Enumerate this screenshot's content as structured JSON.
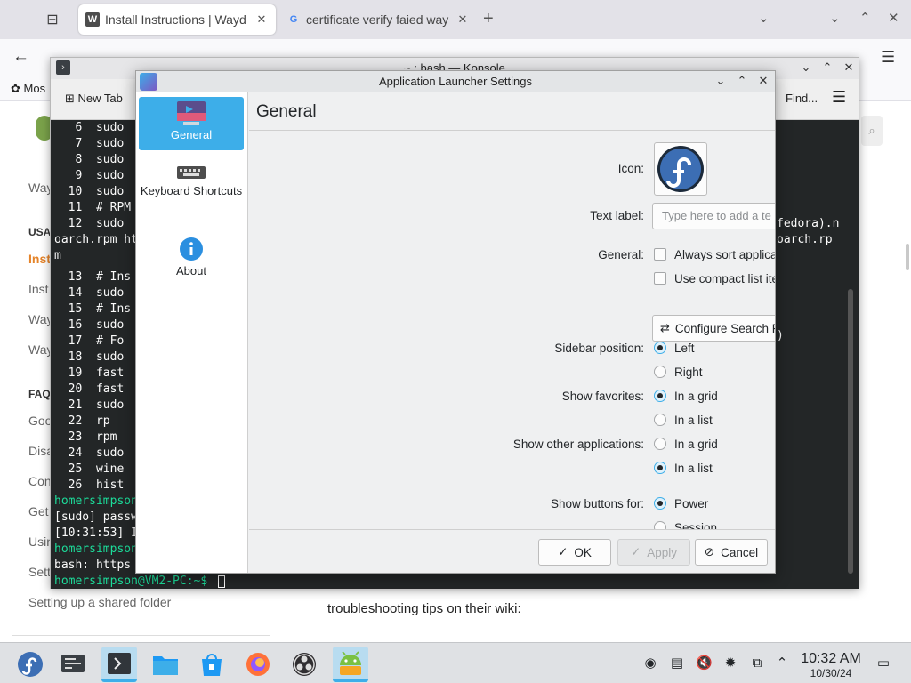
{
  "browser": {
    "tabs": [
      {
        "title": "Install Instructions | Wayd",
        "favicon": "W",
        "active": true
      },
      {
        "title": "certificate verify faied way",
        "favicon": "G",
        "active": false
      }
    ],
    "bookmark_label": "Mos",
    "page": {
      "sidebar_entries": [
        "Way",
        "USA",
        "Inst",
        "Inst",
        "Way",
        "Way",
        "FAQ",
        "Goo",
        "Disa",
        "Con",
        "Get",
        "Usin",
        "Sett",
        "Setting up a shared folder"
      ],
      "body_text": "troubleshooting tips on their wiki:"
    }
  },
  "konsole": {
    "title": "~ : bash — Konsole",
    "toolbar": {
      "new_tab": "New Tab",
      "find": "Find..."
    },
    "left_lines": [
      {
        "text": "   6  sudo",
        "green": false
      },
      {
        "text": "   7  sudo",
        "green": false
      },
      {
        "text": "   8  sudo",
        "green": false
      },
      {
        "text": "   9  sudo",
        "green": false
      },
      {
        "text": "  10  sudo",
        "green": false
      },
      {
        "text": "  11  # RPM",
        "green": false
      },
      {
        "text": "  12  sudo",
        "green": false
      },
      {
        "text": "oarch.rpm ht",
        "green": false
      },
      {
        "text": "m",
        "green": false
      },
      {
        "text": "  13  # Ins",
        "green": false
      },
      {
        "text": "  14  sudo",
        "green": false
      },
      {
        "text": "  15  # Ins",
        "green": false
      },
      {
        "text": "  16  sudo",
        "green": false
      },
      {
        "text": "  17  # Fo",
        "green": false
      },
      {
        "text": "  18  sudo",
        "green": false
      },
      {
        "text": "  19  fast",
        "green": false
      },
      {
        "text": "  20  fast",
        "green": false
      },
      {
        "text": "  21  sudo",
        "green": false
      },
      {
        "text": "  22  rp",
        "green": false
      },
      {
        "text": "  23  rpm",
        "green": false
      },
      {
        "text": "  24  sudo",
        "green": false
      },
      {
        "text": "  25  wine",
        "green": false
      },
      {
        "text": "  26  hist",
        "green": false
      },
      {
        "text": "homersimpson",
        "green": true
      },
      {
        "text": "[sudo] passw",
        "green": false
      },
      {
        "text": "[10:31:53] I",
        "green": false
      },
      {
        "text": "homersimpson",
        "green": true
      },
      {
        "text": "bash: https",
        "green": false
      },
      {
        "text": "homersimpson@VM2-PC:~$",
        "green": true
      }
    ],
    "right_lines": [
      {
        "text": "fedora).n"
      },
      {
        "text": "oarch.rp"
      },
      {
        "text": ")"
      }
    ]
  },
  "dialog": {
    "title": "Application Launcher Settings",
    "categories": [
      {
        "label": "General",
        "icon": "launcher-icon",
        "active": true
      },
      {
        "label": "Keyboard Shortcuts",
        "icon": "keyboard-icon",
        "active": false
      },
      {
        "label": "About",
        "icon": "info-icon",
        "active": false
      }
    ],
    "heading": "General",
    "labels": {
      "icon": "Icon:",
      "text_label": "Text label:",
      "general": "General:",
      "sidebar_position": "Sidebar position:",
      "show_favorites": "Show favorites:",
      "show_other_apps": "Show other applications:",
      "show_buttons": "Show buttons for:"
    },
    "text_label_placeholder": "Type here to add a te",
    "options": {
      "always_sort": {
        "label": "Always sort applica",
        "checked": false
      },
      "compact_list": {
        "label": "Use compact list ite",
        "checked": false
      },
      "sidebar_left": {
        "label": "Left",
        "checked": true
      },
      "sidebar_right": {
        "label": "Right",
        "checked": false
      },
      "fav_grid": {
        "label": "In a grid",
        "checked": true
      },
      "fav_list": {
        "label": "In a list",
        "checked": false
      },
      "other_grid": {
        "label": "In a grid",
        "checked": false
      },
      "other_list": {
        "label": "In a list",
        "checked": true
      },
      "buttons_power": {
        "label": "Power",
        "checked": true
      },
      "buttons_session": {
        "label": "Session",
        "checked": false
      }
    },
    "configure_search_label": "Configure Search F",
    "buttons": {
      "ok": "OK",
      "apply": "Apply",
      "cancel": "Cancel"
    }
  },
  "taskbar": {
    "apps": [
      "fedora-launcher-icon",
      "system-monitor-icon",
      "konsole-icon",
      "files-icon",
      "discover-store-icon",
      "firefox-icon",
      "obs-icon",
      "android-app-icon"
    ],
    "clock": {
      "time": "10:32 AM",
      "date": "10/30/24"
    }
  },
  "colors": {
    "accent": "#3daee9",
    "terminal_bg": "#232627",
    "prompt_green": "#1cdc9a",
    "fedora_blue": "#3c6eb4"
  }
}
